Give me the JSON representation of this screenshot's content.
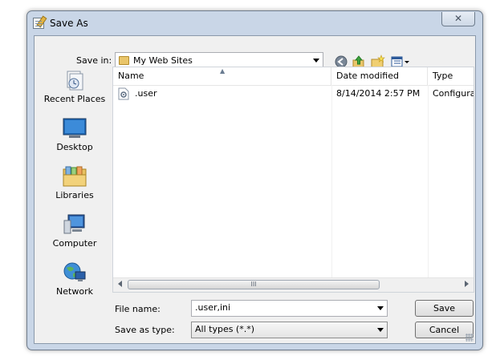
{
  "window": {
    "title": "Save As",
    "close_symbol": "✕"
  },
  "save_in": {
    "label": "Save in:",
    "value": "My Web Sites"
  },
  "toolbar": {
    "icons": [
      "back-icon",
      "up-folder-icon",
      "new-folder-icon",
      "view-menu-icon"
    ]
  },
  "places": [
    {
      "label": "Recent Places",
      "icon": "recent-places-icon"
    },
    {
      "label": "Desktop",
      "icon": "desktop-icon"
    },
    {
      "label": "Libraries",
      "icon": "libraries-icon"
    },
    {
      "label": "Computer",
      "icon": "computer-icon"
    },
    {
      "label": "Network",
      "icon": "network-icon"
    }
  ],
  "file_list": {
    "columns": [
      "Name",
      "Date modified",
      "Type"
    ],
    "rows": [
      {
        "name": ".user",
        "date": "8/14/2014 2:57 PM",
        "type": "Configura"
      }
    ],
    "scroll_grip": "III"
  },
  "file_name": {
    "label": "File name:",
    "value": ".user,ini"
  },
  "save_as_type": {
    "label": "Save as type:",
    "value": "All types (*.*)"
  },
  "buttons": {
    "save": "Save",
    "cancel": "Cancel"
  }
}
